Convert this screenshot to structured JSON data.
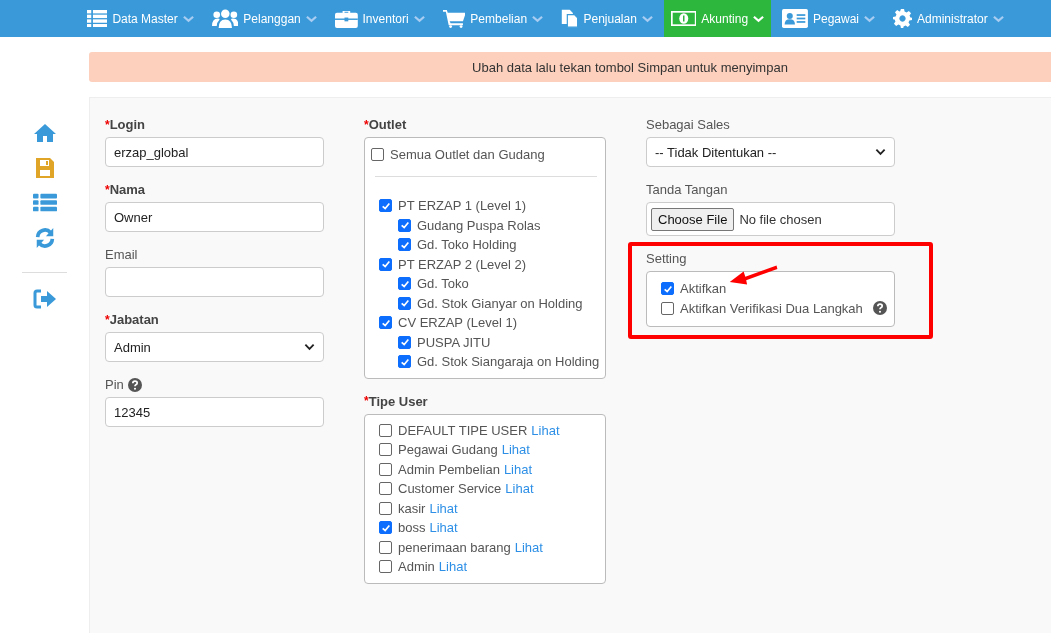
{
  "nav": {
    "items": [
      {
        "label": "Data Master",
        "selected": false
      },
      {
        "label": "Pelanggan",
        "selected": false
      },
      {
        "label": "Inventori",
        "selected": false
      },
      {
        "label": "Pembelian",
        "selected": false
      },
      {
        "label": "Penjualan",
        "selected": false
      },
      {
        "label": "Akunting",
        "selected": true
      },
      {
        "label": "Pegawai",
        "selected": false
      },
      {
        "label": "Administrator",
        "selected": false
      }
    ]
  },
  "banner": "Ubah data lalu tekan tombol Simpan untuk menyimpan",
  "account_fields": [
    {
      "kind": "input",
      "required_mark": "*",
      "label": "Login",
      "value": "erzap_global"
    },
    {
      "kind": "input",
      "required_mark": "*",
      "label": "Nama",
      "value": "Owner"
    },
    {
      "kind": "input",
      "label": "Email"
    },
    {
      "kind": "select",
      "required_mark": "*",
      "label": "Jabatan",
      "value": "Admin"
    },
    {
      "kind": "input",
      "label": "Pin",
      "help": true,
      "value": "12345"
    }
  ],
  "outlet": {
    "required_mark": "*",
    "label": "Outlet",
    "all_option": {
      "label": "Semua Outlet dan Gudang",
      "checked": false
    },
    "groups": [
      {
        "label": "PT ERZAP 1 (Level 1)",
        "checked": true,
        "children": [
          {
            "label": "Gudang Puspa Rolas",
            "checked": true
          },
          {
            "label": "Gd. Toko Holding",
            "checked": true
          }
        ]
      },
      {
        "label": "PT ERZAP 2 (Level 2)",
        "checked": true,
        "children": [
          {
            "label": "Gd. Toko",
            "checked": true
          },
          {
            "label": "Gd. Stok Gianyar on Holding",
            "checked": true
          }
        ]
      },
      {
        "label": "CV ERZAP (Level 1)",
        "checked": true,
        "children": [
          {
            "label": "PUSPA JITU",
            "checked": true
          },
          {
            "label": "Gd. Stok Siangaraja on Holding",
            "checked": true
          }
        ]
      }
    ]
  },
  "tipe_user": {
    "required_mark": "*",
    "label": "Tipe User",
    "items": [
      {
        "label": "DEFAULT TIPE USER",
        "link": "Lihat",
        "checked": false
      },
      {
        "label": "Pegawai Gudang",
        "link": "Lihat",
        "checked": false
      },
      {
        "label": "Admin Pembelian",
        "link": "Lihat",
        "checked": false
      },
      {
        "label": "Customer Service",
        "link": "Lihat",
        "checked": false
      },
      {
        "label": "kasir",
        "link": "Lihat",
        "checked": false
      },
      {
        "label": "boss",
        "link": "Lihat",
        "checked": true
      },
      {
        "label": "penerimaan barang",
        "link": "Lihat",
        "checked": false
      },
      {
        "label": "Admin",
        "link": "Lihat",
        "checked": false
      }
    ]
  },
  "sebagai_sales": {
    "label": "Sebagai Sales",
    "value": "-- Tidak Ditentukan --"
  },
  "tanda_tangan": {
    "label": "Tanda Tangan",
    "button": "Choose File",
    "status": "No file chosen"
  },
  "setting": {
    "label": "Setting",
    "items": [
      {
        "label": "Aktifkan",
        "checked": true
      },
      {
        "label": "Aktifkan Verifikasi Dua Langkah",
        "checked": false,
        "help": true
      }
    ]
  }
}
